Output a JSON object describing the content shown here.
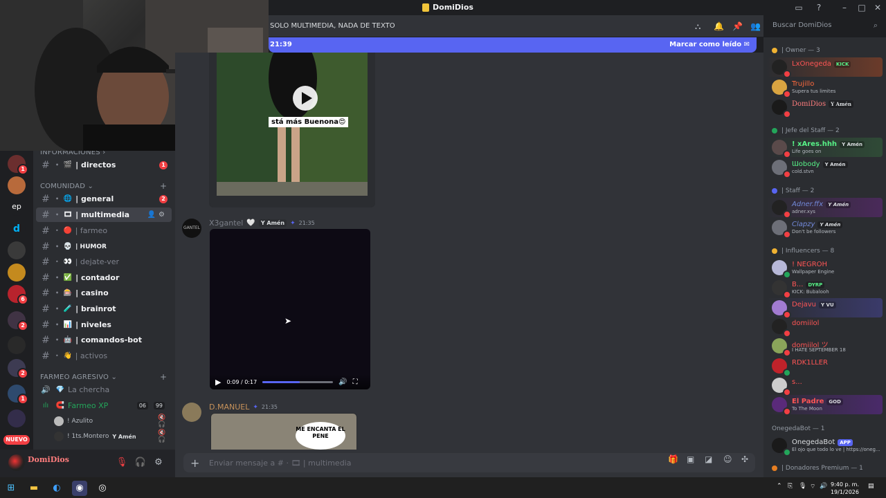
{
  "app": {
    "title": "DomiDios"
  },
  "server_list": {
    "items": [
      {
        "label": "",
        "badge": "1"
      },
      {
        "label": "",
        "badge": ""
      },
      {
        "label": "ep",
        "badge": ""
      },
      {
        "label": "d",
        "badge": ""
      },
      {
        "label": "",
        "badge": ""
      },
      {
        "label": "",
        "badge": ""
      },
      {
        "label": "",
        "badge": "6"
      },
      {
        "label": "",
        "badge": "2"
      },
      {
        "label": "",
        "badge": ""
      },
      {
        "label": "",
        "badge": "2"
      },
      {
        "label": "",
        "badge": "1"
      },
      {
        "label": "",
        "badge": ""
      }
    ],
    "new_badge": "NUEVO"
  },
  "channels": {
    "cat_info": "INFORMACIONES",
    "cat_comunidad": "COMUNIDAD",
    "cat_farmeo": "FARMEO AGRESIVO",
    "items": [
      {
        "name": "| directos",
        "emoji": "🎬",
        "badge": "1"
      },
      {
        "name": "| general",
        "emoji": "🌐",
        "badge": "2"
      },
      {
        "name": "| multimedia",
        "emoji": "🎞",
        "badge": ""
      },
      {
        "name": "| farmeo",
        "emoji": "🔴",
        "badge": ""
      },
      {
        "name": "| HUMOR",
        "emoji": "💀",
        "badge": ""
      },
      {
        "name": "| dejate-ver",
        "emoji": "👀",
        "badge": ""
      },
      {
        "name": "| contador",
        "emoji": "✅",
        "badge": ""
      },
      {
        "name": "| casino",
        "emoji": "🎰",
        "badge": ""
      },
      {
        "name": "| brainrot",
        "emoji": "🧪",
        "badge": ""
      },
      {
        "name": "| niveles",
        "emoji": "📊",
        "badge": ""
      },
      {
        "name": "| comandos-bot",
        "emoji": "🤖",
        "badge": ""
      },
      {
        "name": "| activos",
        "emoji": "👋",
        "badge": ""
      }
    ],
    "voice": [
      {
        "name": "La chercha",
        "emoji": "💎"
      },
      {
        "name": "Farmeo XP",
        "emoji": "🧲",
        "count_a": "06",
        "count_b": "99"
      }
    ],
    "voice_users": [
      {
        "name": "! Azulito",
        "tag": ""
      },
      {
        "name": "! 1ts.Montero",
        "tag": "Y Amén"
      }
    ]
  },
  "user_panel": {
    "name": "DomiDios"
  },
  "header": {
    "topic": "SOLO MULTIMEDIA, NADA DE TEXTO",
    "search_placeholder": "Buscar DomiDios"
  },
  "new_messages_bar": {
    "time": "21:39",
    "mark_read": "Marcar como leído"
  },
  "messages": [
    {
      "author": "",
      "overlay_text": "stá más Buenona😍"
    },
    {
      "author": "X3gantel",
      "heart": "🤍",
      "tag": "Y Amén",
      "time": "21:35",
      "video_time": "0:09 / 0:17",
      "progress": 0.53
    },
    {
      "author": "D.MANUEL",
      "time": "21:35",
      "image_text": "ME ENCANTA EL PENE"
    }
  ],
  "composer": {
    "plus": "+",
    "placeholder": "Enviar mensaje a # · 🎞 | multimedia"
  },
  "members": {
    "groups": [
      {
        "title": "| Owner — 3",
        "color": "#f0b232"
      },
      {
        "title": "| Jefe del Staff — 2",
        "color": "#23a55a"
      },
      {
        "title": "| Staff — 2",
        "color": "#5865f2"
      },
      {
        "title": "| Influencers — 8",
        "color": "#f0b232"
      },
      {
        "title": "OnegedaBot — 1",
        "color": ""
      },
      {
        "title": "| Donadores Premium — 1",
        "color": "#e67e22"
      }
    ],
    "list": [
      {
        "name": "LxOnegeda",
        "sub": "",
        "tag": "KICK",
        "color": "#ff5555"
      },
      {
        "name": "Trujillo",
        "sub": "Supera tus limites",
        "tag": "",
        "color": "#ff6a3d"
      },
      {
        "name": "DomiDios",
        "sub": "",
        "tag": "Y Amén",
        "color": "#ff7d7d"
      },
      {
        "name": "! xAres.hhh",
        "sub": "Life goes on",
        "tag": "Y Amén",
        "color": "#57f287"
      },
      {
        "name": "Ɯobody",
        "sub": "cold.stvn",
        "tag": "Y Amén",
        "color": "#57f287"
      },
      {
        "name": "Adner.ffx",
        "sub": "adner.xys",
        "tag": "Y Amén",
        "color": "#7289da"
      },
      {
        "name": "Clapzy",
        "sub": "Don't be followers",
        "tag": "Y Amén",
        "color": "#7289da"
      },
      {
        "name": "! NEGROH",
        "sub": "Wallpaper Engine",
        "tag": "",
        "color": "#ff5555"
      },
      {
        "name": "B...",
        "sub": "KICK: Bubalooh",
        "tag": "DYRP",
        "color": "#ff5555"
      },
      {
        "name": "Dejavu",
        "sub": "",
        "tag": "Y VU",
        "color": "#ff5555"
      },
      {
        "name": "domiilol",
        "sub": "",
        "tag": "",
        "color": "#ff5555"
      },
      {
        "name": "domiilol ツ",
        "sub": "I HATE SEPTEMBER 18",
        "tag": "",
        "color": "#ff5555"
      },
      {
        "name": "RDK1LLER",
        "sub": "",
        "tag": "",
        "color": "#ff5555"
      },
      {
        "name": "s...",
        "sub": "",
        "tag": "",
        "color": "#ff5555"
      },
      {
        "name": "El Padre",
        "sub": "To The Moon",
        "tag": "GOD",
        "color": "#ff5555"
      },
      {
        "name": "OnegedaBot",
        "sub": "El ojo que todo lo ve | https://oneg...",
        "tag": "APP",
        "color": "#dbdee1"
      }
    ]
  },
  "taskbar": {
    "time": "9:40 p. m.",
    "date": "19/1/2026"
  }
}
